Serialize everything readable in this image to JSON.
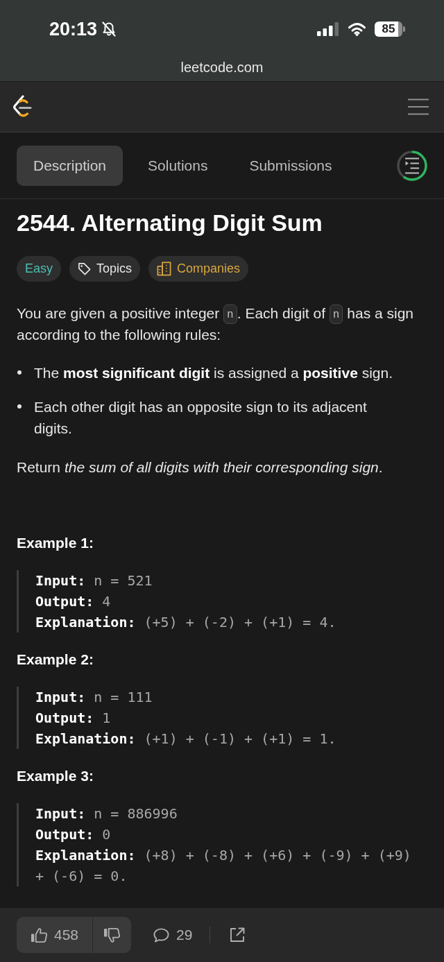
{
  "status_bar": {
    "time": "20:13",
    "battery": "85"
  },
  "browser": {
    "url": "leetcode.com"
  },
  "tabs": [
    {
      "label": "Description",
      "selected": true
    },
    {
      "label": "Solutions",
      "selected": false
    },
    {
      "label": "Submissions",
      "selected": false
    }
  ],
  "problem_list": {
    "level": 0.6
  },
  "problem": {
    "title": "2544. Alternating Digit Sum",
    "tags": [
      {
        "label": "Easy",
        "kind": "difficulty"
      },
      {
        "label": "Topics",
        "kind": "topics"
      },
      {
        "label": "Companies",
        "kind": "companies"
      }
    ],
    "intro": [
      {
        "kind": "text",
        "text": "You are given a positive integer "
      },
      {
        "kind": "code",
        "text": "n"
      },
      {
        "kind": "text",
        "text": ". Each digit of "
      },
      {
        "kind": "code",
        "text": "n"
      },
      {
        "kind": "text",
        "text": " has a sign according to the following rules:"
      }
    ],
    "rules": [
      "The **most significant digit** is assigned a **positive** sign.",
      "Each other digit has an opposite sign to its adjacent digits."
    ],
    "task": "Return *the sum of all digits with their corresponding sign*.",
    "examples": [
      {
        "title": "Example 1:",
        "lines": [
          {
            "label": "Input:",
            "value": "n = 521"
          },
          {
            "label": "Output:",
            "value": "4"
          },
          {
            "label": "Explanation:",
            "value": "(+5) + (-2) + (+1) = 4."
          }
        ]
      },
      {
        "title": "Example 2:",
        "lines": [
          {
            "label": "Input:",
            "value": "n = 111"
          },
          {
            "label": "Output:",
            "value": "1"
          },
          {
            "label": "Explanation:",
            "value": "(+1) + (-1) + (+1) = 1."
          }
        ]
      },
      {
        "title": "Example 3:",
        "lines": [
          {
            "label": "Input:",
            "value": "n = 886996"
          },
          {
            "label": "Output:",
            "value": "0"
          },
          {
            "label": "Explanation:",
            "value": "(+8) + (-8) + (+6) + (-9) + (+9) + (-6) = 0."
          }
        ]
      }
    ]
  },
  "actions": {
    "likes": "458",
    "comments": "29"
  }
}
